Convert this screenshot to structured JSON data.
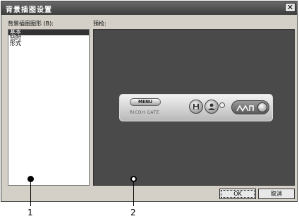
{
  "window": {
    "title": "背景插图设置",
    "close_glyph": "✕"
  },
  "left_panel": {
    "label": "背景插图图形 (B):",
    "items": [
      {
        "label": "基本",
        "selected": true
      },
      {
        "label": "钻时",
        "selected": false
      },
      {
        "label": "形式",
        "selected": false
      }
    ]
  },
  "preview": {
    "label": "预检:",
    "skin": {
      "menu_label": "MENU",
      "brand": "RICOH GATE",
      "button_1_icon": "floppy-disk-icon",
      "button_2_icon": "user-icon",
      "logo_text": "ꟽ"
    }
  },
  "buttons": {
    "ok": "OK",
    "cancel": "取消"
  },
  "callouts": [
    "1",
    "2"
  ]
}
